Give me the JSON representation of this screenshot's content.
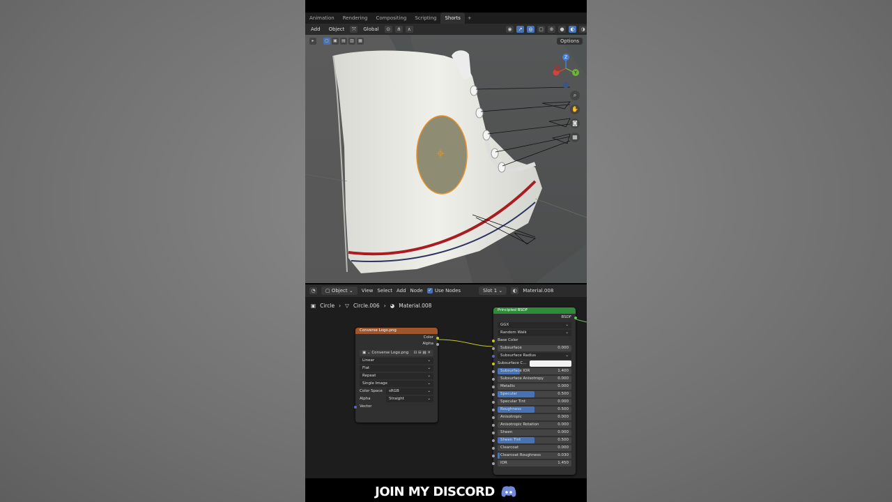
{
  "workspace_tabs": [
    {
      "label": "Animation"
    },
    {
      "label": "Rendering"
    },
    {
      "label": "Compositing"
    },
    {
      "label": "Scripting"
    },
    {
      "label": "Shorts",
      "active": true
    }
  ],
  "tab_add": "+",
  "viewport_header": {
    "add": "Add",
    "object": "Object",
    "transform": "Global",
    "options": "Options"
  },
  "gizmo": {
    "z": "Z",
    "y": "Y",
    "x": "X"
  },
  "node_editor_header": {
    "mode": "Object",
    "view": "View",
    "select": "Select",
    "add": "Add",
    "node": "Node",
    "use_nodes": "Use Nodes",
    "slot": "Slot 1",
    "material": "Material.008"
  },
  "breadcrumb": {
    "object": "Circle",
    "mesh": "Circle.006",
    "material": "Material.008"
  },
  "image_node": {
    "title": "Converse Logo.png",
    "out_color": "Color",
    "out_alpha": "Alpha",
    "image_name": "Converse Logo.png",
    "interpolation": "Linear",
    "projection": "Flat",
    "extension": "Repeat",
    "source": "Single Image",
    "color_space_label": "Color Space",
    "color_space": "sRGB",
    "alpha_label": "Alpha",
    "alpha": "Straight",
    "vector": "Vector"
  },
  "bsdf_node": {
    "title": "Principled BSDF",
    "out": "BSDF",
    "distribution": "GGX",
    "subsurface_method": "Random Walk",
    "base_color": "Base Color",
    "subsurface_radius": "Subsurface Radius",
    "subsurface_color": "Subsurface C...",
    "inputs": [
      {
        "label": "Subsurface",
        "value": "0.000",
        "fill": 0
      },
      {
        "label": "Subsurface IOR",
        "value": "1.400",
        "fill": 0.3
      },
      {
        "label": "Subsurface Anisotropy",
        "value": "0.000",
        "fill": 0
      },
      {
        "label": "Metallic",
        "value": "0.000",
        "fill": 0
      },
      {
        "label": "Specular",
        "value": "0.500",
        "fill": 0.5
      },
      {
        "label": "Specular Tint",
        "value": "0.000",
        "fill": 0
      },
      {
        "label": "Roughness",
        "value": "0.500",
        "fill": 0.5
      },
      {
        "label": "Anisotropic",
        "value": "0.000",
        "fill": 0
      },
      {
        "label": "Anisotropic Rotation",
        "value": "0.000",
        "fill": 0
      },
      {
        "label": "Sheen",
        "value": "0.000",
        "fill": 0
      },
      {
        "label": "Sheen Tint",
        "value": "0.500",
        "fill": 0.5
      },
      {
        "label": "Clearcoat",
        "value": "0.000",
        "fill": 0
      },
      {
        "label": "Clearcoat Roughness",
        "value": "0.030",
        "fill": 0.03
      },
      {
        "label": "IOR",
        "value": "1.450",
        "fill": 0
      }
    ]
  },
  "overlay": {
    "text": "JOIN MY DISCORD"
  }
}
